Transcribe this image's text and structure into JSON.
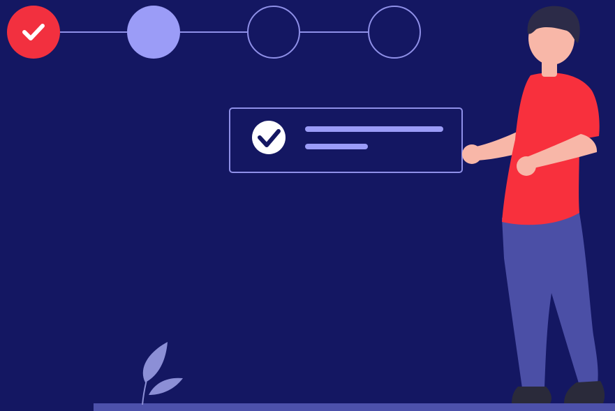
{
  "colors": {
    "background": "#141762",
    "accent_red": "#f2303f",
    "step_active": "#9b9cf7",
    "outline": "#8f90e8",
    "skin": "#f8b7a8",
    "hair": "#2c2b48",
    "shirt": "#f8303d",
    "pants": "#4b4fa6",
    "shoes": "#2a2a3a",
    "floor": "#4d51ab",
    "plant": "#8c8fd6"
  },
  "progress": {
    "total_steps": 4,
    "completed_steps": 1,
    "current_step": 2
  },
  "icons": {
    "step_done": "check-icon",
    "card": "check-circle-icon"
  }
}
